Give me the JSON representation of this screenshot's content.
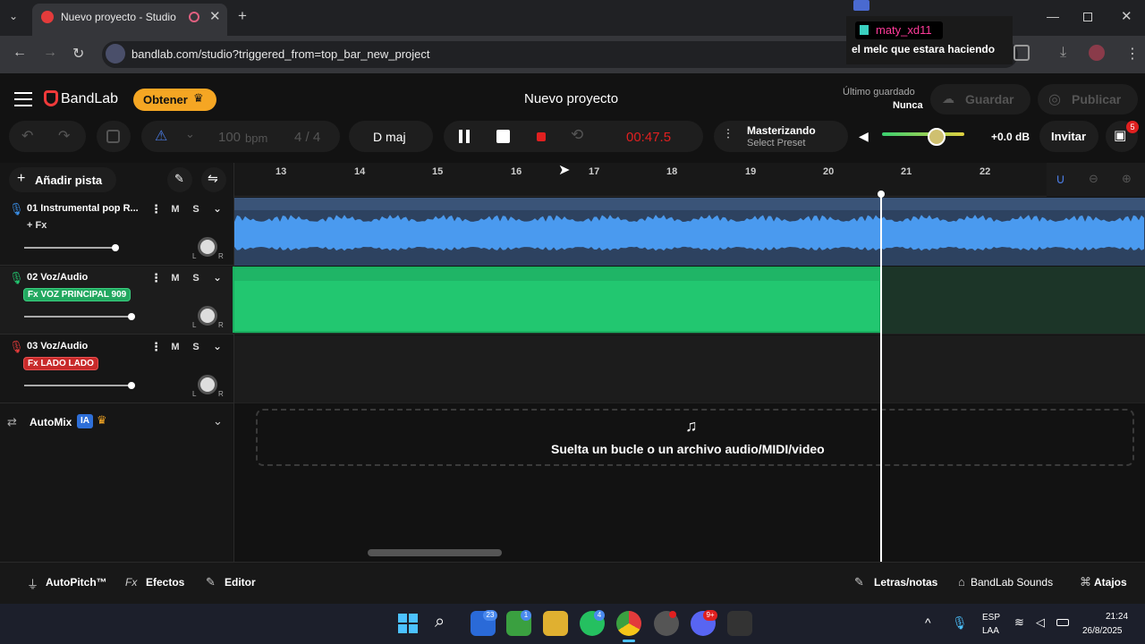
{
  "browser": {
    "tab_title": "Nuevo proyecto - Studio",
    "url": "bandlab.com/studio?triggered_from=top_bar_new_project"
  },
  "overlay": {
    "username": "maty_xd11",
    "message": "el melc que estara haciendo"
  },
  "app": {
    "logo": "BandLab",
    "obtener": "Obtener",
    "project_title": "Nuevo proyecto",
    "last_saved_label": "Último guardado",
    "last_saved_value": "Nunca",
    "save": "Guardar",
    "publish": "Publicar",
    "bpm_value": "100",
    "bpm_unit": "bpm",
    "time_sig": "4 / 4",
    "key": "D maj",
    "time": "00:47.5",
    "master_title": "Masterizando",
    "master_preset": "Select Preset",
    "db": "+0.0 dB",
    "invite": "Invitar",
    "gift_badge": "5",
    "add_track": "Añadir pista"
  },
  "ruler": [
    "13",
    "14",
    "15",
    "16",
    "17",
    "18",
    "19",
    "20",
    "21",
    "22"
  ],
  "tracks": [
    {
      "name": "01  Instrumental pop R...",
      "fx": "+ Fx",
      "m": "M",
      "s": "S",
      "pan_l": "L",
      "pan_r": "R"
    },
    {
      "name": "02  Voz/Audio",
      "fx": "Fx VOZ PRINCIPAL 909",
      "m": "M",
      "s": "S",
      "pan_l": "L",
      "pan_r": "R"
    },
    {
      "name": "03  Voz/Audio",
      "fx": "Fx LADO LADO",
      "m": "M",
      "s": "S",
      "pan_l": "L",
      "pan_r": "R"
    }
  ],
  "automix": {
    "label": "AutoMix",
    "badge": "IA"
  },
  "dropzone": "Suelta un bucle o un archivo audio/MIDI/video",
  "bottom": {
    "autopitch": "AutoPitch™",
    "efectos_prefix": "Fx",
    "efectos": "Efectos",
    "editor": "Editor",
    "letras": "Letras/notas",
    "sounds": "BandLab Sounds",
    "atajos": "Atajos"
  },
  "taskbar": {
    "lang1": "ESP",
    "lang2": "LAA",
    "time": "21:24",
    "date": "26/8/2025",
    "badge_mail": "23",
    "badge_xbox": "1",
    "badge_wa": "4",
    "badge_discord": "9+"
  },
  "colors": {
    "accent_orange": "#f5a623",
    "track1": "#3a8ee6",
    "track2": "#22c770",
    "track3": "#e33b3b",
    "rec": "#e02020"
  }
}
